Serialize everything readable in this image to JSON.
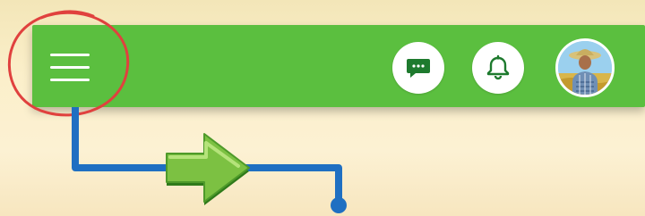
{
  "header": {
    "background_color": "#5bbf3f",
    "menu_icon": "hamburger-menu-icon",
    "actions": [
      {
        "name": "messages",
        "icon": "chat-bubble-icon",
        "icon_color": "#1e7a2e"
      },
      {
        "name": "notifications",
        "icon": "bell-icon",
        "icon_color": "#1e7a2e"
      }
    ],
    "profile": {
      "icon": "user-avatar"
    }
  },
  "annotation": {
    "highlight_color": "#e0413e",
    "connector_color": "#1f6fc2",
    "arrow_color": "#7cc142"
  }
}
